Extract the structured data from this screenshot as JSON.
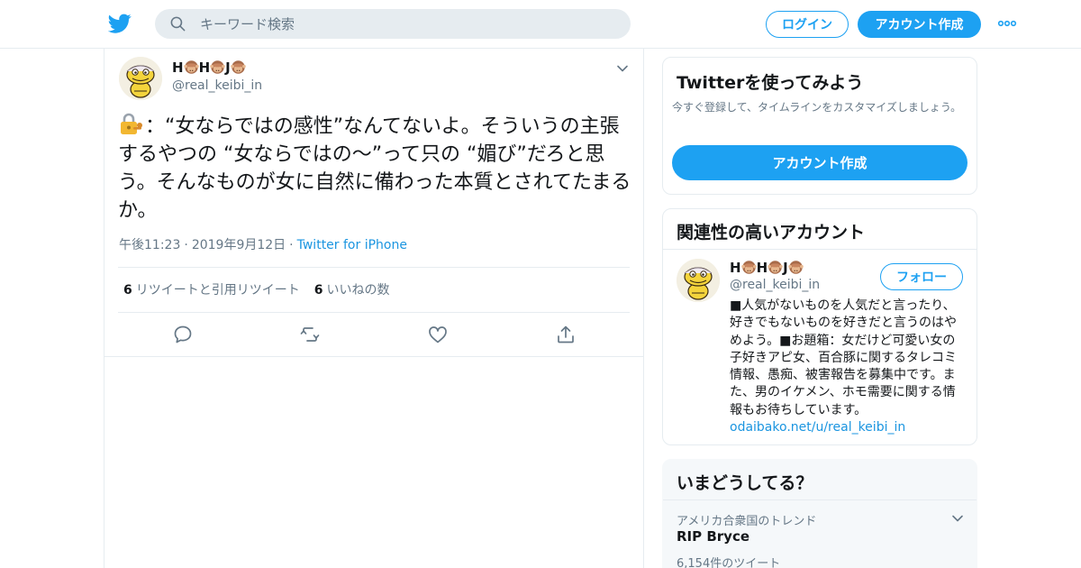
{
  "colors": {
    "accent": "#1da1f2",
    "link": "#1b95e0",
    "text_primary": "#14171a",
    "text_secondary": "#657786",
    "border": "#e6ecf0",
    "trend_bg": "#f5f8fa"
  },
  "header": {
    "logo_icon": "twitter-bird-icon",
    "search_placeholder": "キーワード検索",
    "login_label": "ログイン",
    "signup_label": "アカウント作成",
    "more_icon": "more-dots-icon"
  },
  "tweet": {
    "author_name_parts": [
      "H",
      "H",
      "J"
    ],
    "name_emoji": "see-no-evil-monkey",
    "handle": "@real_keibi_in",
    "lock_emoji": "locked-with-key",
    "text": "：“女ならではの感性”なんてないよ。そういうの主張するやつの “女ならではの〜”って只の “媚び”だろと思う。そんなものが女に自然に備わった本質とされてたまるか。",
    "time": "午後11:23",
    "date": "2019年9月12日",
    "separator": "·",
    "source": "Twitter for iPhone",
    "retweets_count": "6",
    "retweets_label": "リツイートと引用リツイート",
    "likes_count": "6",
    "likes_label": "いいねの数",
    "actions": [
      "reply-icon",
      "retweet-icon",
      "like-icon",
      "share-icon"
    ]
  },
  "signup_card": {
    "title": "Twitterを使ってみよう",
    "subtitle": "今すぐ登録して、タイムラインをカスタマイズしましょう。",
    "button_label": "アカウント作成"
  },
  "related_card": {
    "title": "関連性の高いアカウント",
    "handle": "@real_keibi_in",
    "follow_label": "フォロー",
    "bio": "■人気がないものを人気だと言ったり、好きでもないものを好きだと言うのはやめよう。■お題箱：女だけど可愛い女の子好きアピ女、百合豚に関するタレコミ情報、愚痴、被害報告を募集中です。また、男のイケメン、ホモ需要に関する情報もお待ちしています。",
    "bio_link": "odaibako.net/u/real_keibi_in"
  },
  "trends_card": {
    "title": "いまどうしてる？",
    "context": "アメリカ合衆国のトレンド",
    "name": "RIP Bryce",
    "count": "6,154件のツイート"
  }
}
